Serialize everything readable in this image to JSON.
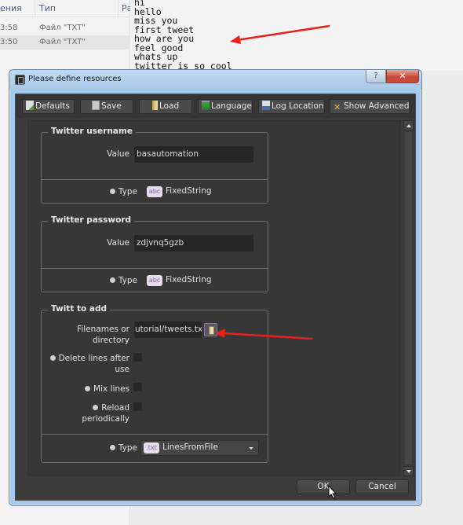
{
  "explorer": {
    "columns": [
      "ения",
      "Тип",
      "Ра"
    ],
    "rows": [
      {
        "time": "3:58",
        "type": "Файл \"TXT\"",
        "selected": false
      },
      {
        "time": "3:50",
        "type": "Файл \"TXT\"",
        "selected": true
      }
    ]
  },
  "notepad": {
    "lines": [
      "hi",
      "hello",
      "miss you",
      "first tweet",
      "how are you",
      "feel good",
      "whats up",
      "twitter is so cool"
    ]
  },
  "dialog": {
    "title": "Please define resources",
    "help_label": "?",
    "close_label": "✕",
    "toolbar": {
      "defaults": "Defaults",
      "save": "Save",
      "load": "Load",
      "language": "Language",
      "log_location": "Log Location",
      "show_advanced": "Show Advanced"
    },
    "groups": {
      "username": {
        "title": "Twitter username",
        "value_label": "Value",
        "value": "basautomation",
        "type_label": "Type",
        "type_badge": "abc",
        "type_name": "FixedString"
      },
      "password": {
        "title": "Twitter password",
        "value_label": "Value",
        "value": "zdjvnq5gzb",
        "type_label": "Type",
        "type_badge": "abc",
        "type_name": "FixedString"
      },
      "tweets": {
        "title": "Twitt to add",
        "filenames_label": "Filenames or directory",
        "filenames_value": "utorial/tweets.txt",
        "delete_lines_label": "Delete lines after use",
        "delete_lines_checked": false,
        "mix_lines_label": "Mix lines",
        "mix_lines_checked": false,
        "reload_label": "Reload periodically",
        "reload_checked": false,
        "type_label": "Type",
        "type_badge": ".txt",
        "type_name": "LinesFromFile"
      }
    },
    "ok_label": "OK",
    "cancel_label": "Cancel"
  },
  "colors": {
    "annotation_arrow": "#e8201a",
    "dialog_bg": "#3c3c3c",
    "type_badge_text": "#8a5ab0"
  }
}
